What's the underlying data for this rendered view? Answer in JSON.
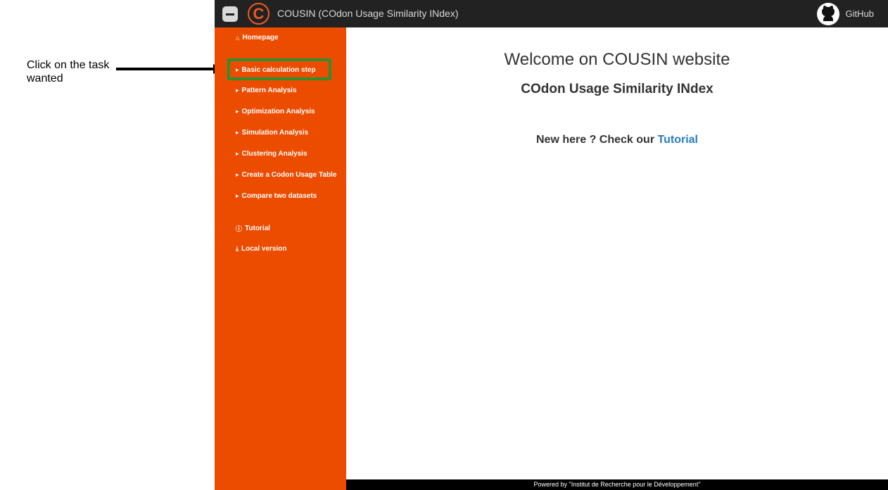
{
  "annotation": {
    "text": "Click on the task wanted"
  },
  "header": {
    "title": "COUSIN (COdon Usage Similarity INdex)",
    "logo_letter": "C",
    "github_label": "GitHub"
  },
  "sidebar": {
    "homepage": "Homepage",
    "tasks": [
      "Basic calculation step",
      "Pattern Analysis",
      "Optimization Analysis",
      "Simulation Analysis",
      "Clustering Analysis",
      "Create a Codon Usage Table",
      "Compare two datasets"
    ],
    "tutorial": "Tutorial",
    "local_version": "Local version"
  },
  "main": {
    "welcome": "Welcome on COUSIN website",
    "subtitle": "COdon Usage Similarity INdex",
    "new_here": "New here ? Check our",
    "tutorial_link": "Tutorial"
  },
  "footer": {
    "text": "Powered by \"Institut de Recherche pour le Développement\""
  },
  "colors": {
    "sidebar": "#ec4c00",
    "topbar": "#222222",
    "highlight": "#2f8f2f",
    "link": "#2b7bbf"
  }
}
